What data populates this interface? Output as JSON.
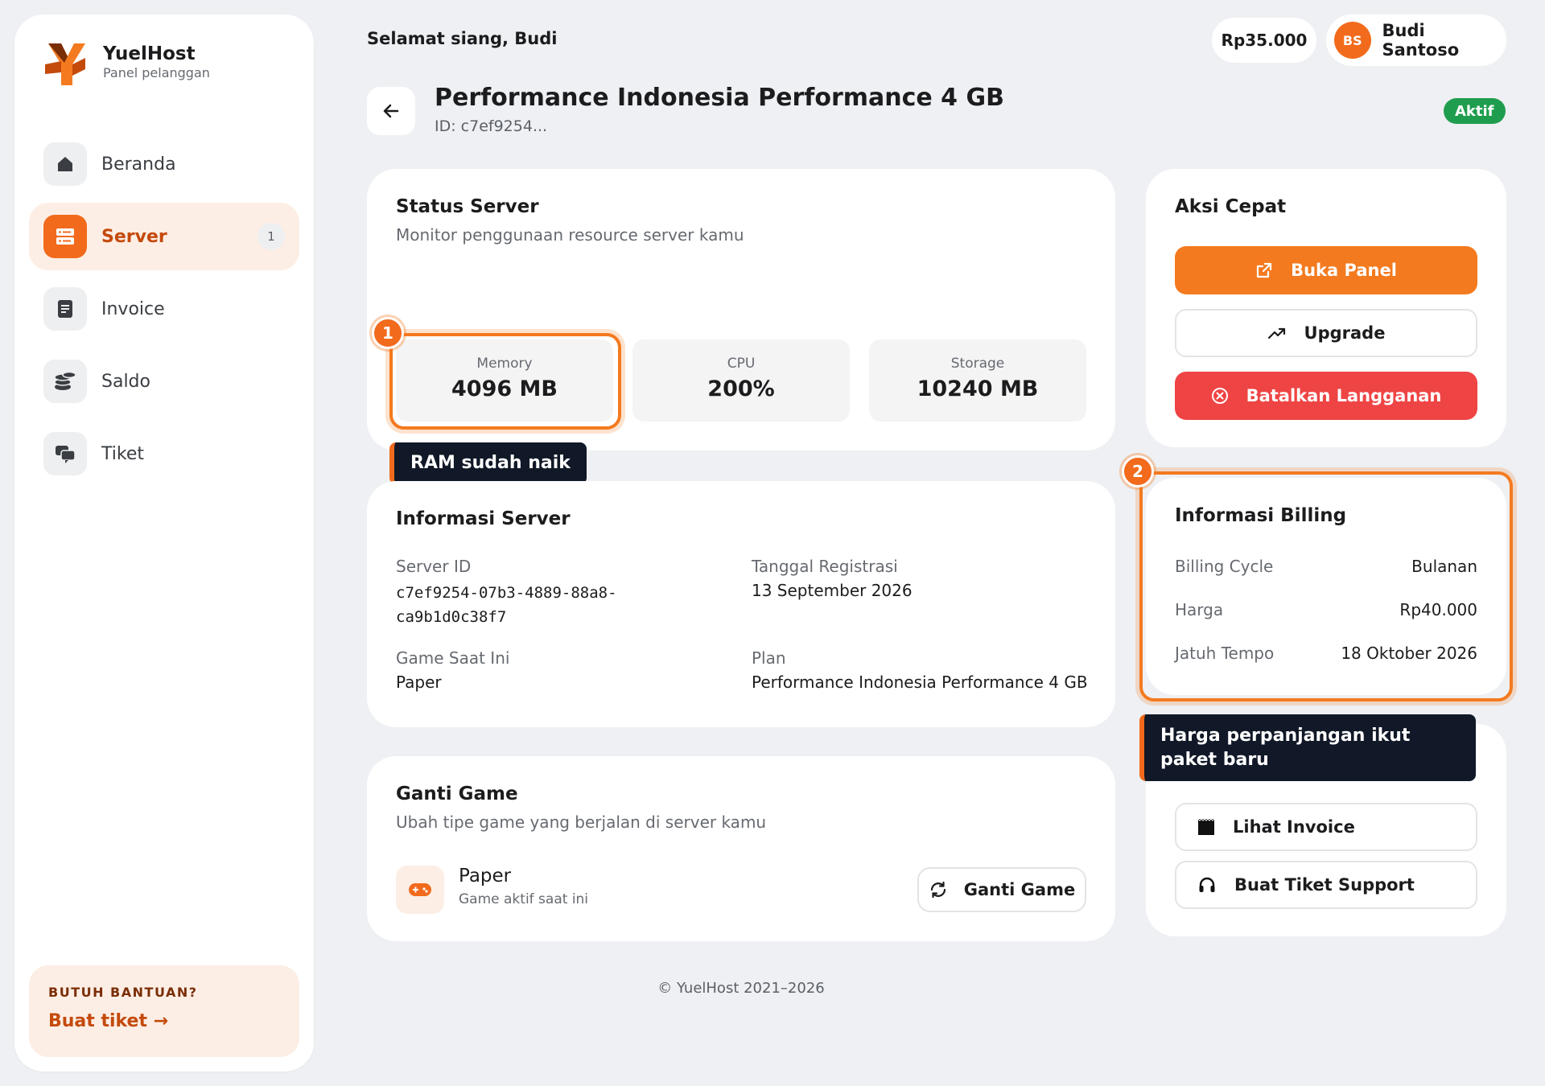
{
  "sidebar": {
    "brand_name": "YuelHost",
    "brand_sub": "Panel pelanggan",
    "items": [
      {
        "label": "Beranda",
        "icon": "home-icon"
      },
      {
        "label": "Server",
        "icon": "server-icon",
        "badge": "1",
        "active": true
      },
      {
        "label": "Invoice",
        "icon": "document-icon"
      },
      {
        "label": "Saldo",
        "icon": "coins-icon"
      },
      {
        "label": "Tiket",
        "icon": "chat-icon"
      }
    ],
    "help": {
      "title": "BUTUH BANTUAN?",
      "link": "Buat tiket →"
    }
  },
  "header": {
    "greeting": "Selamat siang, Budi",
    "balance": "Rp35.000",
    "user": {
      "initials": "BS",
      "name": "Budi Santoso"
    }
  },
  "page": {
    "title": "Performance Indonesia Performance 4 GB",
    "id_label": "ID: c7ef9254...",
    "status": "Aktif"
  },
  "status_server": {
    "title": "Status Server",
    "subtitle": "Monitor penggunaan resource server kamu",
    "resources": [
      {
        "label": "Memory",
        "value": "4096 MB"
      },
      {
        "label": "CPU",
        "value": "200%"
      },
      {
        "label": "Storage",
        "value": "10240 MB"
      }
    ]
  },
  "annotations": [
    {
      "number": "1",
      "text": "RAM sudah naik"
    },
    {
      "number": "2",
      "text": "Harga perpanjangan ikut paket baru"
    }
  ],
  "info_server": {
    "title": "Informasi Server",
    "server_id_label": "Server ID",
    "server_id_line1": "c7ef9254-07b3-4889-88a8-",
    "server_id_line2": "ca9b1d0c38f7",
    "reg_label": "Tanggal Registrasi",
    "reg_value": "13 September 2026",
    "game_label": "Game Saat Ini",
    "game_value": "Paper",
    "plan_label": "Plan",
    "plan_value": "Performance Indonesia Performance 4 GB"
  },
  "ganti_game": {
    "title": "Ganti Game",
    "subtitle": "Ubah tipe game yang berjalan di server kamu",
    "game_name": "Paper",
    "game_sub": "Game aktif saat ini",
    "button": "Ganti Game"
  },
  "aksi_cepat": {
    "title": "Aksi Cepat",
    "buka_panel": "Buka Panel",
    "upgrade": "Upgrade",
    "batalkan": "Batalkan Langganan"
  },
  "billing": {
    "title": "Informasi Billing",
    "rows": [
      {
        "key": "Billing Cycle",
        "value": "Bulanan"
      },
      {
        "key": "Harga",
        "value": "Rp40.000"
      },
      {
        "key": "Jatuh Tempo",
        "value": "18 Oktober 2026"
      }
    ]
  },
  "links": {
    "lihat_invoice": "Lihat Invoice",
    "buat_tiket": "Buat Tiket Support"
  },
  "footer": "© YuelHost 2021–2026",
  "colors": {
    "accent": "#f26a1b",
    "danger": "#ef4444",
    "success": "#1f9d4e",
    "tooltip_bg": "#111827"
  }
}
